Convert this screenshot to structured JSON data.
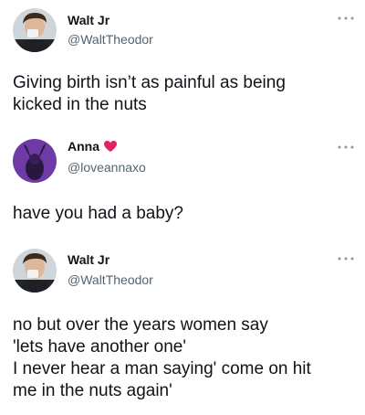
{
  "tweets": [
    {
      "display_name": "Walt Jr",
      "handle": "@WaltTheodor",
      "more_icon": "more-horizontal-icon",
      "text": "Giving birth isn’t as painful as being\nkicked in the nuts"
    },
    {
      "display_name": "Anna",
      "handle": "@loveannaxo",
      "badge_icon": "red-heart-emoji",
      "more_icon": "more-horizontal-icon",
      "text": "have you had a baby?"
    },
    {
      "display_name": "Walt Jr",
      "handle": "@WaltTheodor",
      "more_icon": "more-horizontal-icon",
      "text": "no but over the years women say\n'lets have another one'\nI never hear a man saying' come on hit\nme in the nuts again'"
    }
  ],
  "colors": {
    "text": "#0f1419",
    "secondary": "#536471",
    "anna_avatar_bg": "#6e3aa6",
    "heart": "#e0245e"
  }
}
